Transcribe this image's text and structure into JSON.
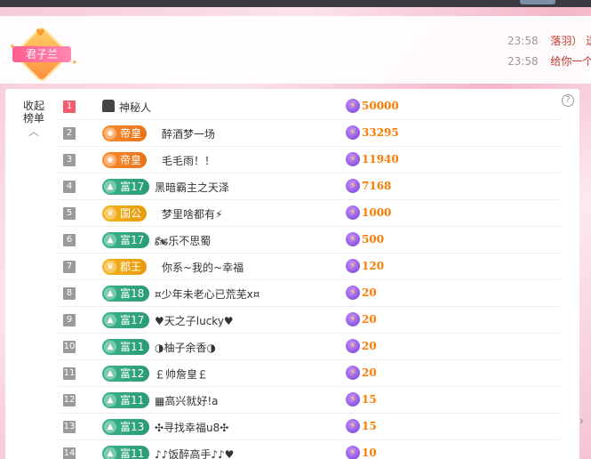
{
  "chat": {
    "badge_label": "君子兰",
    "lines": [
      {
        "time": "23:58",
        "text": "落羽）  送"
      },
      {
        "time": "23:58",
        "text": "给你一个"
      }
    ]
  },
  "panel": {
    "collapse_label_1": "收起",
    "collapse_label_2": "榜单",
    "help": "?"
  },
  "rows": [
    {
      "rank": "1",
      "level": "",
      "name": "神秘人",
      "score": "50000"
    },
    {
      "rank": "2",
      "level": "帝皇",
      "name": "醉酒梦一场",
      "score": "33295"
    },
    {
      "rank": "3",
      "level": "帝皇",
      "name": "毛毛雨！！",
      "score": "11940"
    },
    {
      "rank": "4",
      "level": "富17",
      "name": "黑暗霸主之天泽",
      "score": "7168"
    },
    {
      "rank": "5",
      "level": "国公",
      "name": "梦里啥都有⚡",
      "score": "1000"
    },
    {
      "rank": "6",
      "level": "富17",
      "name": "🏍乐不思蜀",
      "score": "500"
    },
    {
      "rank": "7",
      "level": "郡王",
      "name": "你系~我的~幸福",
      "score": "120"
    },
    {
      "rank": "8",
      "level": "富18",
      "name": "¤少年未老心已荒芜x¤",
      "score": "20"
    },
    {
      "rank": "9",
      "level": "富17",
      "name": "♥天之子lucky♥",
      "score": "20"
    },
    {
      "rank": "10",
      "level": "富11",
      "name": "◑柚子余香◑",
      "score": "20"
    },
    {
      "rank": "11",
      "level": "富12",
      "name": "￡帅詹皇￡",
      "score": "20"
    },
    {
      "rank": "12",
      "level": "富11",
      "name": "▦高兴就好!a",
      "score": "15"
    },
    {
      "rank": "13",
      "level": "富13",
      "name": "✣寻找幸福u8✣",
      "score": "15"
    },
    {
      "rank": "14",
      "level": "富11",
      "name": "♪♪饭醉高手♪♪♥",
      "score": "10"
    }
  ]
}
